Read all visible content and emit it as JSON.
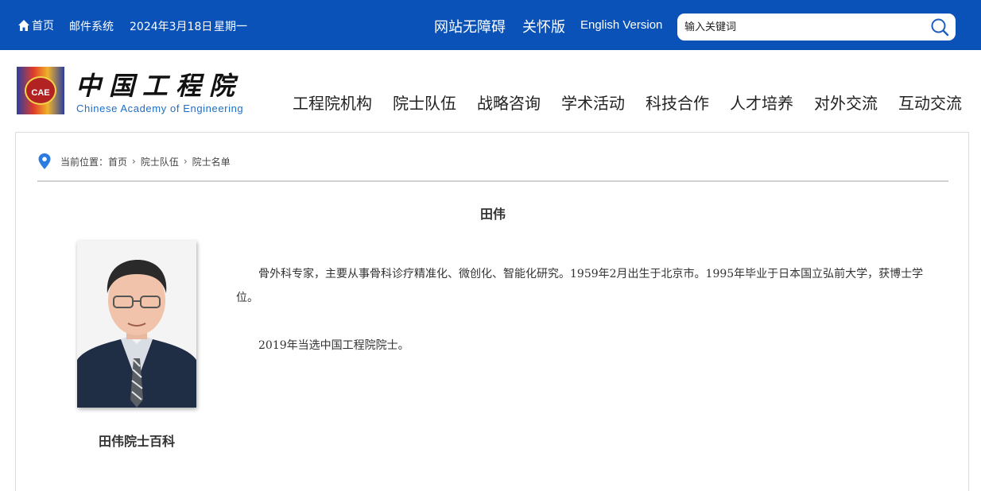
{
  "topbar": {
    "home_label": "首页",
    "mail_label": "邮件系统",
    "date": "2024年3月18日",
    "weekday": "星期一",
    "accessibility_label": "网站无障碍",
    "care_label": "关怀版",
    "english_label": "English Version",
    "search_placeholder": "输入关键词",
    "search_value": "",
    "bg_color": "#0a52b8"
  },
  "logo": {
    "badge_text": "CAE",
    "name_cn": "中国工程院",
    "name_en": "Chinese Academy of Engineering"
  },
  "nav": {
    "items": [
      "工程院机构",
      "院士队伍",
      "战略咨询",
      "学术活动",
      "科技合作",
      "人才培养",
      "对外交流",
      "互动交流"
    ]
  },
  "breadcrumb": {
    "prefix": "当前位置：",
    "items": [
      "首页",
      "院士队伍",
      "院士名单"
    ]
  },
  "profile": {
    "name": "田伟",
    "photo_caption": "田伟院士百科",
    "bio": [
      "骨外科专家，主要从事骨科诊疗精准化、微创化、智能化研究。1959年2月出生于北京市。1995年毕业于日本国立弘前大学，获博士学位。",
      "2019年当选中国工程院院士。"
    ]
  },
  "icons": {
    "home": "home-icon",
    "search": "search-icon",
    "location": "location-pin-icon",
    "chevron": "chevron-right-icon"
  }
}
